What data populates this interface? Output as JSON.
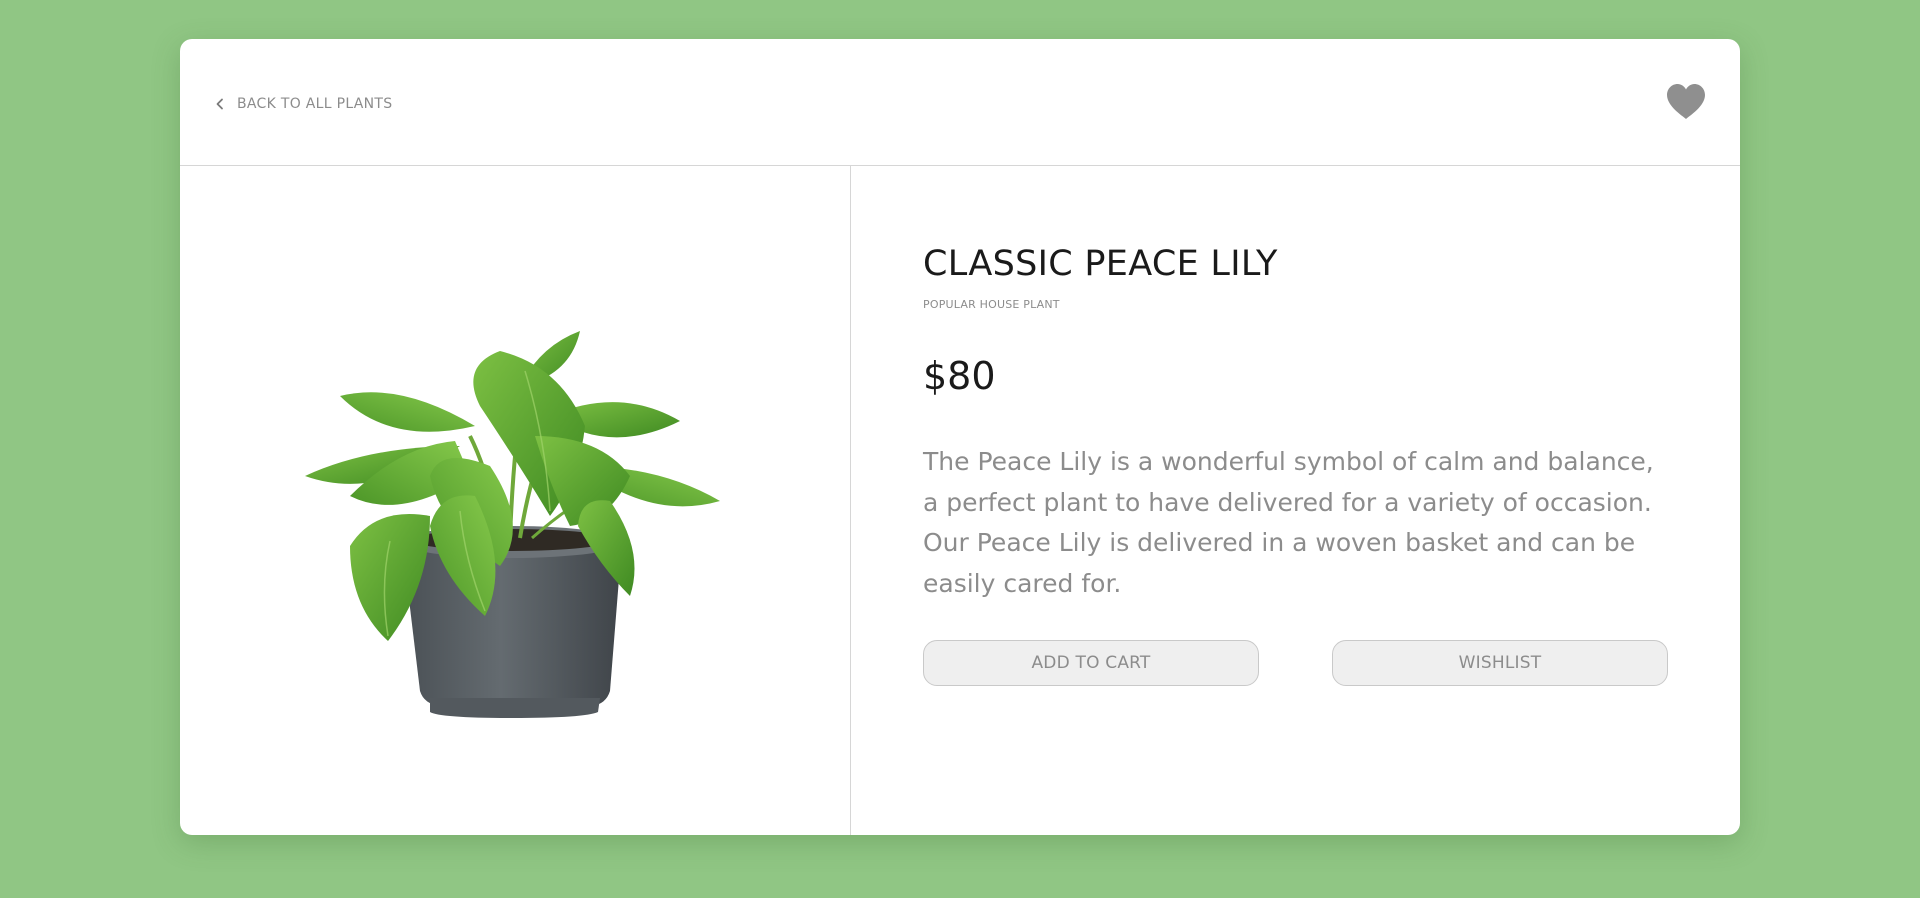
{
  "header": {
    "back_label": "BACK TO ALL PLANTS"
  },
  "product": {
    "title": "CLASSIC PEACE LILY",
    "subtitle": "POPULAR HOUSE PLANT",
    "price": "$80",
    "description": "The Peace Lily is a wonderful symbol of calm and balance, a perfect plant to have delivered for a variety of occasion. Our Peace Lily is delivered in a woven basket and can be easily cared for."
  },
  "actions": {
    "add_to_cart_label": "ADD TO CART",
    "wishlist_label": "WISHLIST"
  },
  "icons": {
    "back": "chevron-left-icon",
    "favorite": "heart-icon"
  },
  "colors": {
    "page_background": "#90c684",
    "card_background": "#ffffff",
    "muted_text": "#8c8c8c",
    "heading_text": "#1a1a1a",
    "button_background": "#efefef",
    "heart": "#8f8f8f",
    "pot": "#5b6166",
    "leaf": "#5fa52f"
  }
}
